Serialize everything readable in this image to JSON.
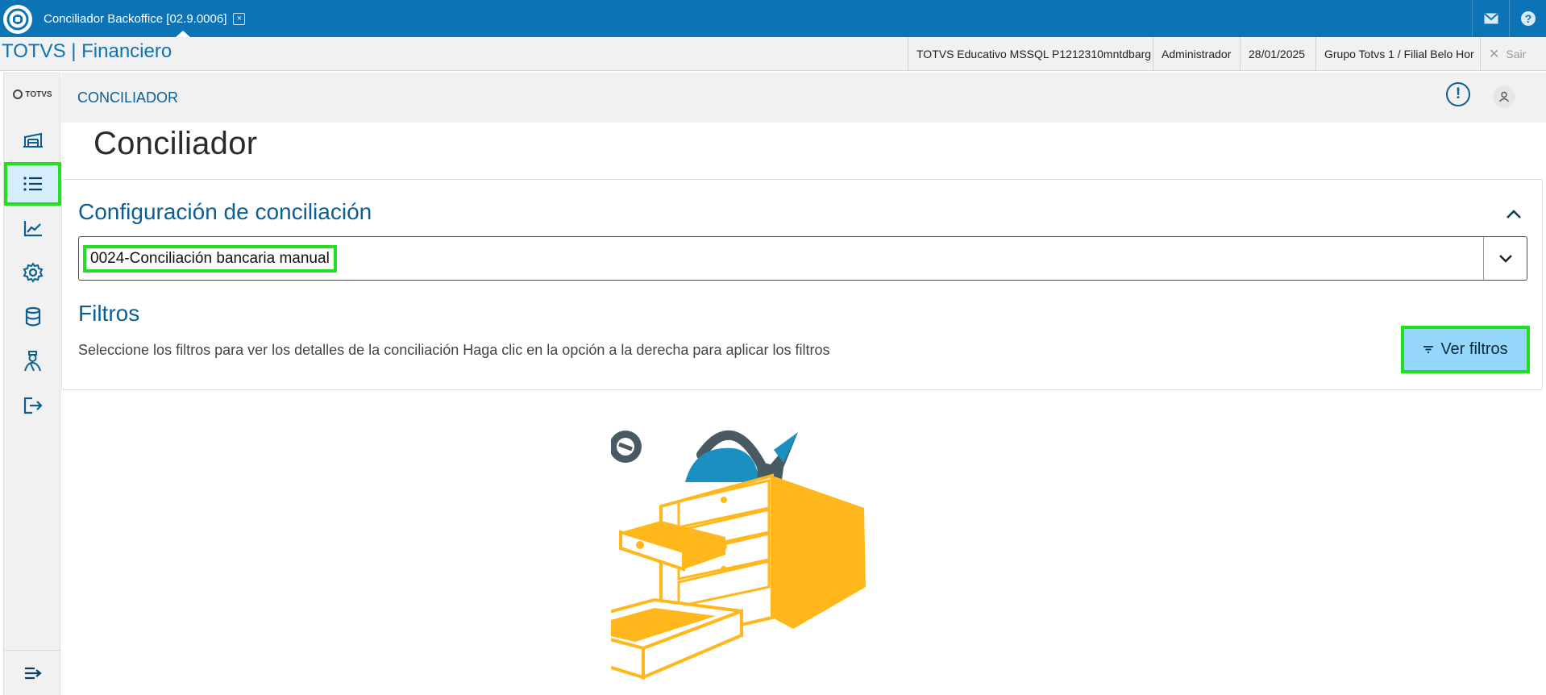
{
  "window": {
    "tab_title": "Conciliador Backoffice [02.9.0006]",
    "tab_close": "×"
  },
  "infobar": {
    "app_title": "TOTVS | Financiero",
    "environment": "TOTVS Educativo MSSQL P1212310mntdbarg",
    "user": "Administrador",
    "date": "28/01/2025",
    "branch": "Grupo Totvs 1 / Filial Belo Hor",
    "exit_label": "Sair"
  },
  "sidebar": {
    "brand": "TOTVS",
    "items": [
      {
        "icon": "building-icon"
      },
      {
        "icon": "list-icon",
        "active": true
      },
      {
        "icon": "chart-icon"
      },
      {
        "icon": "gear-icon"
      },
      {
        "icon": "database-icon"
      },
      {
        "icon": "person-icon"
      },
      {
        "icon": "logout-icon"
      }
    ],
    "collapse_icon": "menu-collapse-icon"
  },
  "header": {
    "section_label": "CONCILIADOR",
    "warn_symbol": "!"
  },
  "page": {
    "title": "Conciliador"
  },
  "config": {
    "title": "Configuración de conciliación",
    "selected_value": "0024-Conciliación bancaria manual"
  },
  "filters": {
    "title": "Filtros",
    "description": "Seleccione los filtros para ver los detalles de la conciliación Haga clic en la opción a la derecha para aplicar los filtros",
    "button_label": "Ver filtros"
  },
  "colors": {
    "brand_blue": "#0b73b6",
    "heading_blue": "#0b5f94",
    "highlight_green": "#23e01c",
    "button_bg": "#95d6fb",
    "illustration_yellow": "#ffb71b"
  }
}
